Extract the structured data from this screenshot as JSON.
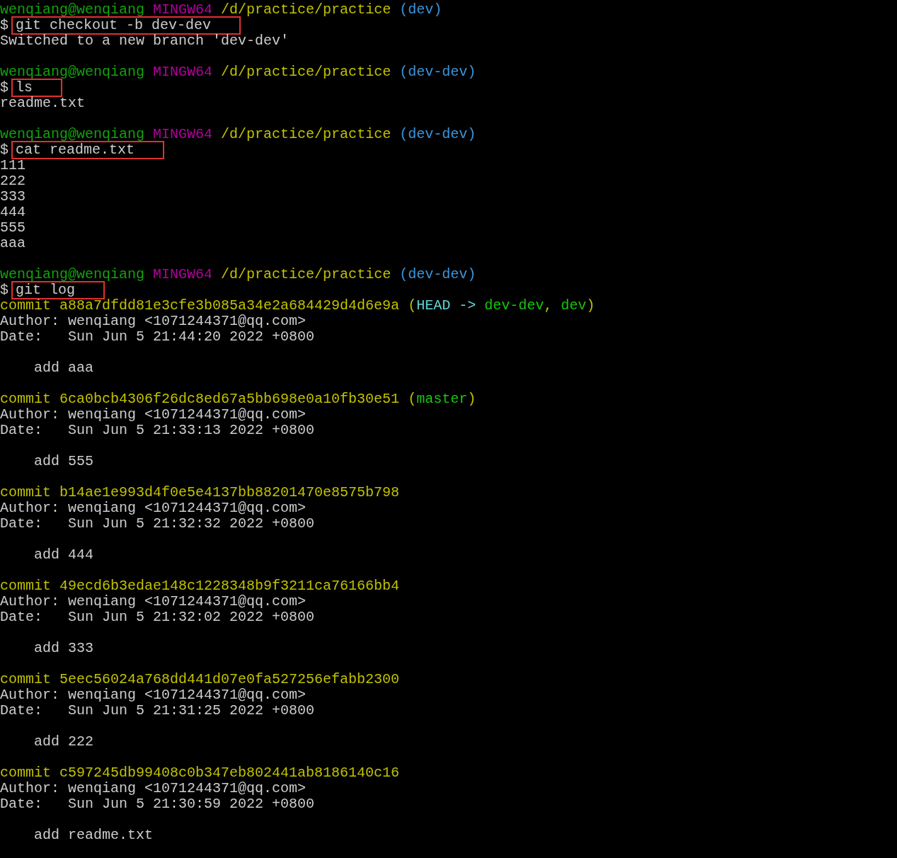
{
  "terminal_lines": [
    {
      "kind": "prompt",
      "user": "wenqiang@wenqiang",
      "system": "MINGW64",
      "path": "/d/practice/practice",
      "branch": "(dev)"
    },
    {
      "kind": "command",
      "prompt": "$",
      "text": "git checkout -b dev-dev",
      "highlighted": true
    },
    {
      "kind": "output",
      "text": "Switched to a new branch 'dev-dev'"
    },
    {
      "kind": "blank"
    },
    {
      "kind": "prompt",
      "user": "wenqiang@wenqiang",
      "system": "MINGW64",
      "path": "/d/practice/practice",
      "branch": "(dev-dev)"
    },
    {
      "kind": "command",
      "prompt": "$",
      "text": "ls",
      "highlighted": true
    },
    {
      "kind": "output",
      "text": "readme.txt"
    },
    {
      "kind": "blank"
    },
    {
      "kind": "prompt",
      "user": "wenqiang@wenqiang",
      "system": "MINGW64",
      "path": "/d/practice/practice",
      "branch": "(dev-dev)"
    },
    {
      "kind": "command",
      "prompt": "$",
      "text": "cat readme.txt",
      "highlighted": true
    },
    {
      "kind": "output",
      "text": "111"
    },
    {
      "kind": "output",
      "text": "222"
    },
    {
      "kind": "output",
      "text": "333"
    },
    {
      "kind": "output",
      "text": "444"
    },
    {
      "kind": "output",
      "text": "555"
    },
    {
      "kind": "output",
      "text": "aaa"
    },
    {
      "kind": "blank"
    },
    {
      "kind": "prompt",
      "user": "wenqiang@wenqiang",
      "system": "MINGW64",
      "path": "/d/practice/practice",
      "branch": "(dev-dev)"
    },
    {
      "kind": "command",
      "prompt": "$",
      "text": "git log",
      "highlighted": true
    },
    {
      "kind": "commit",
      "label": "commit",
      "hash": "a88a7dfdd81e3cfe3b085a34e2a684429d4d6e9a",
      "refs": [
        {
          "kind": "punct",
          "text": "("
        },
        {
          "kind": "head",
          "text": "HEAD ->"
        },
        {
          "kind": "branch",
          "text": "dev-dev"
        },
        {
          "kind": "punct",
          "text": ","
        },
        {
          "kind": "branch",
          "text": "dev"
        },
        {
          "kind": "punct",
          "text": ")"
        }
      ]
    },
    {
      "kind": "output",
      "text": "Author: wenqiang <1071244371@qq.com>"
    },
    {
      "kind": "output",
      "text": "Date:   Sun Jun 5 21:44:20 2022 +0800"
    },
    {
      "kind": "blank"
    },
    {
      "kind": "output",
      "text": "    add aaa"
    },
    {
      "kind": "blank"
    },
    {
      "kind": "commit",
      "label": "commit",
      "hash": "6ca0bcb4306f26dc8ed67a5bb698e0a10fb30e51",
      "refs": [
        {
          "kind": "punct",
          "text": "("
        },
        {
          "kind": "branch",
          "text": "master"
        },
        {
          "kind": "punct",
          "text": ")"
        }
      ]
    },
    {
      "kind": "output",
      "text": "Author: wenqiang <1071244371@qq.com>"
    },
    {
      "kind": "output",
      "text": "Date:   Sun Jun 5 21:33:13 2022 +0800"
    },
    {
      "kind": "blank"
    },
    {
      "kind": "output",
      "text": "    add 555"
    },
    {
      "kind": "blank"
    },
    {
      "kind": "commit",
      "label": "commit",
      "hash": "b14ae1e993d4f0e5e4137bb88201470e8575b798"
    },
    {
      "kind": "output",
      "text": "Author: wenqiang <1071244371@qq.com>"
    },
    {
      "kind": "output",
      "text": "Date:   Sun Jun 5 21:32:32 2022 +0800"
    },
    {
      "kind": "blank"
    },
    {
      "kind": "output",
      "text": "    add 444"
    },
    {
      "kind": "blank"
    },
    {
      "kind": "commit",
      "label": "commit",
      "hash": "49ecd6b3edae148c1228348b9f3211ca76166bb4"
    },
    {
      "kind": "output",
      "text": "Author: wenqiang <1071244371@qq.com>"
    },
    {
      "kind": "output",
      "text": "Date:   Sun Jun 5 21:32:02 2022 +0800"
    },
    {
      "kind": "blank"
    },
    {
      "kind": "output",
      "text": "    add 333"
    },
    {
      "kind": "blank"
    },
    {
      "kind": "commit",
      "label": "commit",
      "hash": "5eec56024a768dd441d07e0fa527256efabb2300"
    },
    {
      "kind": "output",
      "text": "Author: wenqiang <1071244371@qq.com>"
    },
    {
      "kind": "output",
      "text": "Date:   Sun Jun 5 21:31:25 2022 +0800"
    },
    {
      "kind": "blank"
    },
    {
      "kind": "output",
      "text": "    add 222"
    },
    {
      "kind": "blank"
    },
    {
      "kind": "commit",
      "label": "commit",
      "hash": "c597245db99408c0b347eb802441ab8186140c16"
    },
    {
      "kind": "output",
      "text": "Author: wenqiang <1071244371@qq.com>"
    },
    {
      "kind": "output",
      "text": "Date:   Sun Jun 5 21:30:59 2022 +0800"
    },
    {
      "kind": "blank"
    },
    {
      "kind": "output",
      "text": "    add readme.txt"
    }
  ]
}
